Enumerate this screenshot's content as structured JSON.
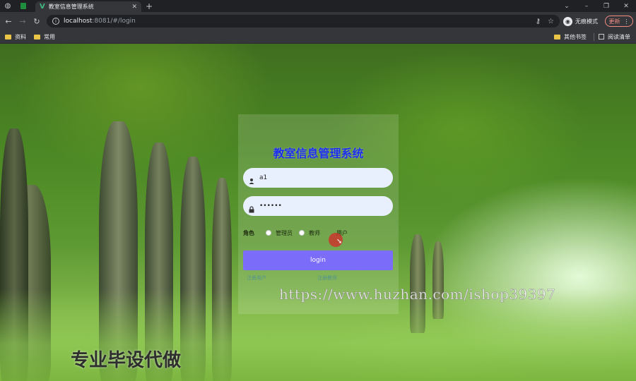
{
  "browser": {
    "tab_title": "教室信息管理系统",
    "url_host": "localhost",
    "url_path": ":8081/#/login",
    "profile_label": "无痕模式",
    "update_label": "更新",
    "bookmarks": [
      "资料",
      "常用"
    ],
    "bookmarks_right": [
      "其他书签",
      "阅读清单"
    ]
  },
  "icons": {
    "minimize": "–",
    "restore": "❐",
    "close": "✕",
    "dropdown": "⌄",
    "back": "←",
    "forward": "→",
    "reload": "↻",
    "new_tab": "+",
    "tab_close": "✕",
    "key": "⚷",
    "star": "☆",
    "more": "⋮",
    "info": "i",
    "vue": "V",
    "globe": "◍",
    "user": "👤",
    "lock": "🔒",
    "pointer": "➘"
  },
  "login": {
    "title": "教室信息管理系统",
    "username_value": "a1",
    "password_value": "••••••",
    "role_label": "角色",
    "roles": [
      "管理员",
      "教师",
      "用户"
    ],
    "button_label": "login",
    "links": [
      "注册用户",
      "注册教师"
    ]
  },
  "overlay": {
    "watermark": "https://www.huzhan.com/ishop39397",
    "slogan": "专业毕设代做"
  },
  "colors": {
    "title": "#1b2ef0",
    "button": "#7b6cfa",
    "input_bg": "#e8f0fe",
    "update": "#f28b82"
  }
}
